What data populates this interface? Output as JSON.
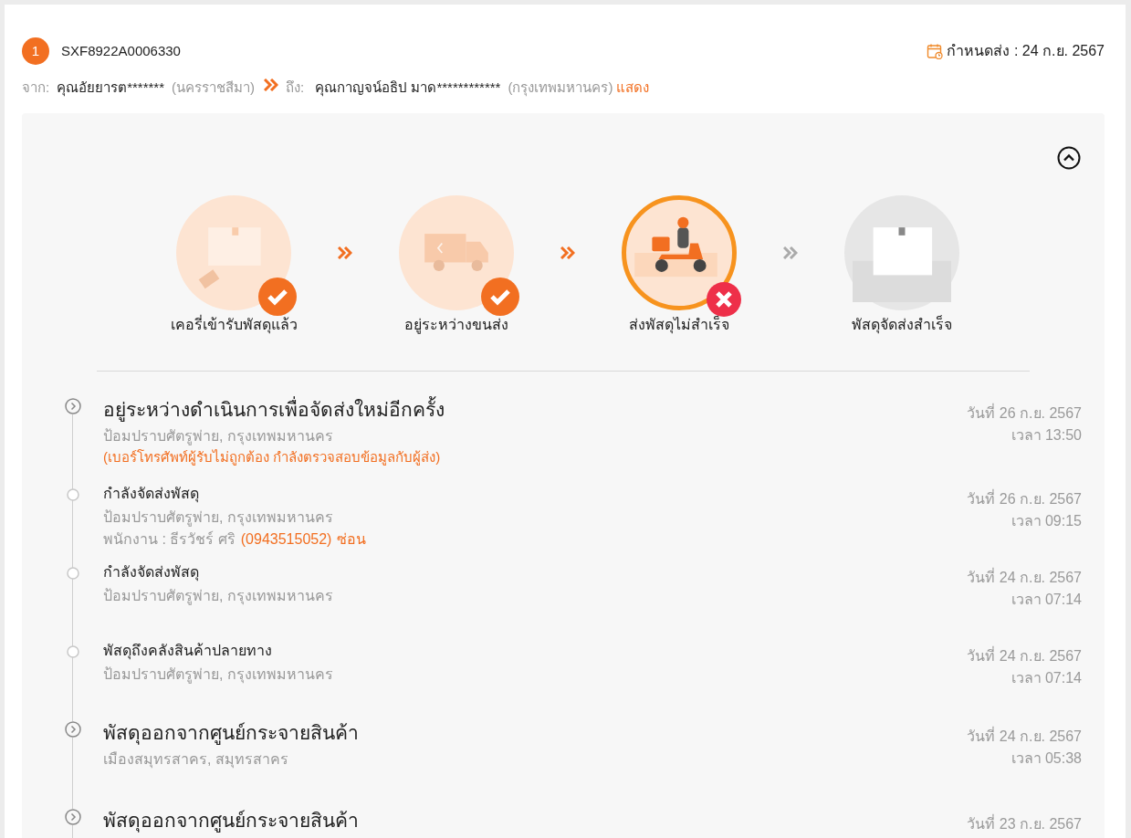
{
  "shipment": {
    "number": "1",
    "tracking_no": "SXF8922A0006330",
    "due_label": "กำหนดส่ง : 24 ก.ย. 2567",
    "from_label": "จาก:",
    "sender": "คุณอัยยารต*******",
    "sender_city": "(นครราชสีมา)",
    "to_label": "ถึง:",
    "receiver": "คุณกาญจน์อธิป มาด************",
    "receiver_city": "(กรุงเทพมหานคร)",
    "show_link": "แสดง"
  },
  "steps": [
    {
      "label": "เคอรี่เข้ารับพัสดุแล้ว",
      "kind": "parcel",
      "completed": true,
      "failed": false
    },
    {
      "label": "อยู่ระหว่างขนส่ง",
      "kind": "truck",
      "completed": true,
      "failed": false
    },
    {
      "label": "ส่งพัสดุไม่สำเร็จ",
      "kind": "scooter",
      "completed": false,
      "failed": true
    },
    {
      "label": "พัสดุจัดส่งสำเร็จ",
      "kind": "box",
      "completed": false,
      "failed": false
    }
  ],
  "events": [
    {
      "kind": "major",
      "title": "อยู่ระหว่างดำเนินการเพื่อจัดส่งใหม่อีกครั้ง",
      "place": "ป้อมปราบศัตรูพ่าย, กรุงเทพมหานคร",
      "note": "(เบอร์โทรศัพท์ผู้รับไม่ถูกต้อง กำลังตรวจสอบข้อมูลกับผู้ส่ง)",
      "date": "วันที่ 26 ก.ย. 2567",
      "time": "เวลา 13:50"
    },
    {
      "kind": "minor",
      "title": "กำลังจัดส่งพัสดุ",
      "place": "ป้อมปราบศัตรูพ่าย, กรุงเทพมหานคร",
      "staff": "พนักงาน : ธีรวัชร์ ศริ",
      "phone": "(0943515052)",
      "hide_link": "ซ่อน",
      "date": "วันที่ 26 ก.ย. 2567",
      "time": "เวลา 09:15"
    },
    {
      "kind": "minor",
      "title": "กำลังจัดส่งพัสดุ",
      "place": "ป้อมปราบศัตรูพ่าย, กรุงเทพมหานคร",
      "date": "วันที่ 24 ก.ย. 2567",
      "time": "เวลา 07:14"
    },
    {
      "kind": "minor",
      "title": "พัสดุถึงคลังสินค้าปลายทาง",
      "place": "ป้อมปราบศัตรูพ่าย, กรุงเทพมหานคร",
      "date": "วันที่ 24 ก.ย. 2567",
      "time": "เวลา 07:14"
    },
    {
      "kind": "major",
      "title": "พัสดุออกจากศูนย์กระจายสินค้า",
      "place": "เมืองสมุทรสาคร, สมุทรสาคร",
      "date": "วันที่ 24 ก.ย. 2567",
      "time": "เวลา 05:38"
    },
    {
      "kind": "major",
      "title": "พัสดุออกจากศูนย์กระจายสินค้า",
      "date": "วันที่ 23 ก.ย. 2567"
    }
  ]
}
